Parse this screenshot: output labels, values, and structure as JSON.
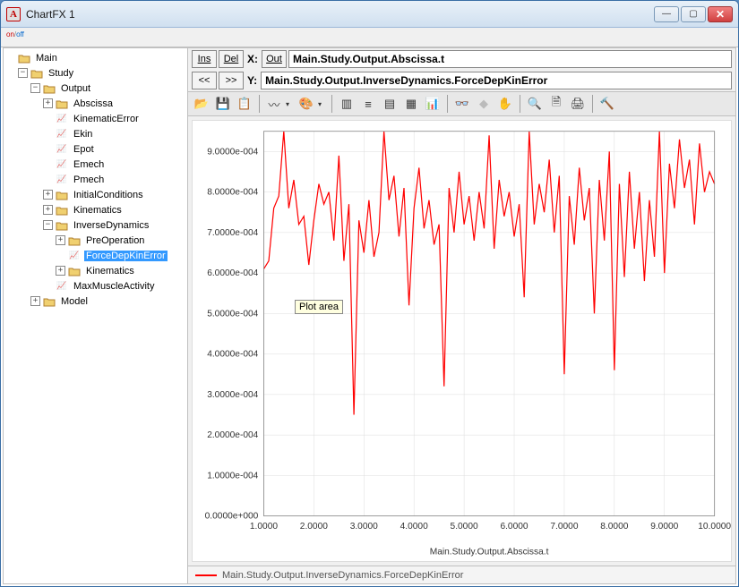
{
  "window": {
    "title": "ChartFX 1"
  },
  "toggle": {
    "on": "on",
    "off": "off"
  },
  "tree": {
    "root": "Main",
    "study": "Study",
    "output": "Output",
    "abscissa": "Abscissa",
    "kinerr": "KinematicError",
    "ekin": "Ekin",
    "epot": "Epot",
    "emech": "Emech",
    "pmech": "Pmech",
    "initcond": "InitialConditions",
    "kinematics_out": "Kinematics",
    "invdyn": "InverseDynamics",
    "preop": "PreOperation",
    "forcedep": "ForceDepKinError",
    "kin_id": "Kinematics",
    "maxmuscle": "MaxMuscleActivity",
    "model": "Model"
  },
  "controls": {
    "ins": "Ins",
    "del": "Del",
    "out": "Out",
    "x_label": "X:",
    "y_label": "Y:",
    "prev": "<<",
    "next": ">>",
    "x_value": "Main.Study.Output.Abscissa.t",
    "y_value": "Main.Study.Output.InverseDynamics.ForceDepKinError"
  },
  "chart_data": {
    "type": "line",
    "xlabel": "Main.Study.Output.Abscissa.t",
    "ylabel": "",
    "xlim": [
      1.0,
      10.0
    ],
    "ylim": [
      0.0,
      0.00095
    ],
    "xticks": [
      "1.0000",
      "2.0000",
      "3.0000",
      "4.0000",
      "5.0000",
      "6.0000",
      "7.0000",
      "8.0000",
      "9.0000",
      "10.0000"
    ],
    "yticks": [
      "0.0000e+000",
      "1.0000e-004",
      "2.0000e-004",
      "3.0000e-004",
      "4.0000e-004",
      "5.0000e-004",
      "6.0000e-004",
      "7.0000e-004",
      "8.0000e-004",
      "9.0000e-004"
    ],
    "ytick_values": [
      0.0,
      0.0001,
      0.0002,
      0.0003,
      0.0004,
      0.0005,
      0.0006,
      0.0007,
      0.0008,
      0.0009
    ],
    "series": [
      {
        "name": "Main.Study.Output.InverseDynamics.ForceDepKinError",
        "color": "#ff0000",
        "x": [
          1.0,
          1.1,
          1.2,
          1.3,
          1.4,
          1.5,
          1.6,
          1.7,
          1.8,
          1.9,
          2.0,
          2.1,
          2.2,
          2.3,
          2.4,
          2.5,
          2.6,
          2.7,
          2.8,
          2.9,
          3.0,
          3.1,
          3.2,
          3.3,
          3.4,
          3.5,
          3.6,
          3.7,
          3.8,
          3.9,
          4.0,
          4.1,
          4.2,
          4.3,
          4.4,
          4.5,
          4.6,
          4.7,
          4.8,
          4.9,
          5.0,
          5.1,
          5.2,
          5.3,
          5.4,
          5.5,
          5.6,
          5.7,
          5.8,
          5.9,
          6.0,
          6.1,
          6.2,
          6.3,
          6.4,
          6.5,
          6.6,
          6.7,
          6.8,
          6.9,
          7.0,
          7.1,
          7.2,
          7.3,
          7.4,
          7.5,
          7.6,
          7.7,
          7.8,
          7.9,
          8.0,
          8.1,
          8.2,
          8.3,
          8.4,
          8.5,
          8.6,
          8.7,
          8.8,
          8.9,
          9.0,
          9.1,
          9.2,
          9.3,
          9.4,
          9.5,
          9.6,
          9.7,
          9.8,
          9.9,
          10.0
        ],
        "y": [
          0.00061,
          0.00063,
          0.00076,
          0.00079,
          0.00095,
          0.00076,
          0.00083,
          0.00072,
          0.00074,
          0.00062,
          0.00073,
          0.00082,
          0.00077,
          0.0008,
          0.00068,
          0.00089,
          0.00063,
          0.00077,
          0.00025,
          0.00073,
          0.00065,
          0.00078,
          0.00064,
          0.0007,
          0.00095,
          0.00078,
          0.00084,
          0.00069,
          0.00081,
          0.00052,
          0.00076,
          0.00086,
          0.00071,
          0.00078,
          0.00067,
          0.00072,
          0.00032,
          0.00081,
          0.0007,
          0.00085,
          0.00072,
          0.00079,
          0.00068,
          0.0008,
          0.00071,
          0.00094,
          0.00066,
          0.00083,
          0.00074,
          0.0008,
          0.00069,
          0.00077,
          0.00054,
          0.00095,
          0.00072,
          0.00082,
          0.00075,
          0.00088,
          0.0007,
          0.00084,
          0.00035,
          0.00079,
          0.00067,
          0.00086,
          0.00073,
          0.00081,
          0.0005,
          0.00083,
          0.00068,
          0.0009,
          0.00036,
          0.00082,
          0.00059,
          0.00085,
          0.00066,
          0.0008,
          0.00058,
          0.00078,
          0.00064,
          0.00095,
          0.0006,
          0.00087,
          0.00076,
          0.00093,
          0.00081,
          0.00088,
          0.00072,
          0.00092,
          0.0008,
          0.00085,
          0.00082
        ]
      }
    ],
    "tooltip": "Plot area"
  },
  "legend": {
    "label": "Main.Study.Output.InverseDynamics.ForceDepKinError"
  }
}
